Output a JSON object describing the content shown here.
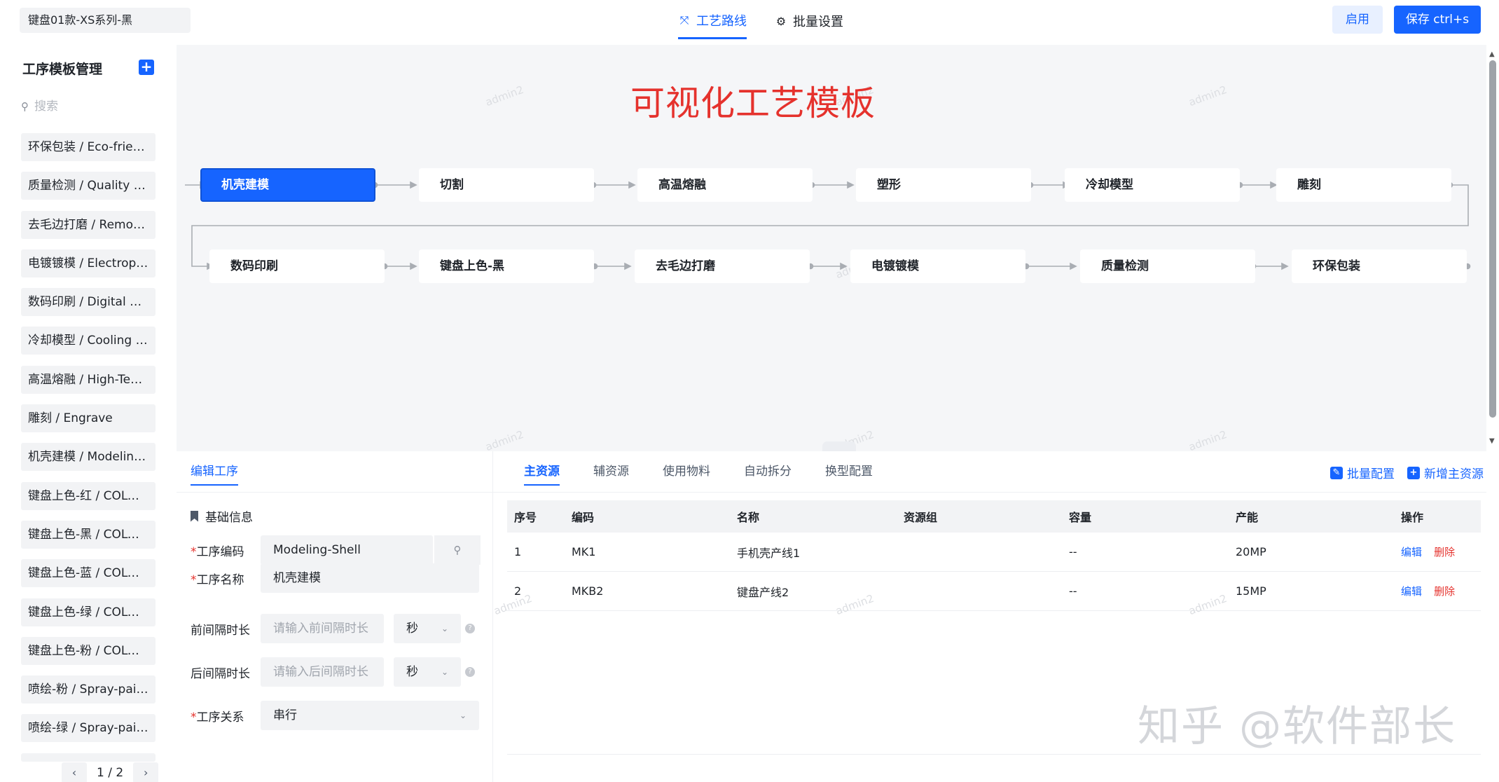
{
  "product": "键盘01款-XS系列-黑",
  "top_tabs": [
    {
      "label": "工艺路线",
      "icon": "route-icon",
      "active": true
    },
    {
      "label": "批量设置",
      "icon": "gear-icon",
      "active": false
    }
  ],
  "buttons": {
    "enable": "启用",
    "save": "保存 ctrl+s"
  },
  "sidebar": {
    "title": "工序模板管理",
    "search_placeholder": "搜索",
    "items": [
      "环保包装 / Eco-friendly Packaging",
      "质量检测 / Quality Inspection",
      "去毛边打磨 / Remove Burrs",
      "电镀镀模 / Electroplating",
      "数码印刷 / Digital Printing",
      "冷却模型 / Cooling Model",
      "高温熔融 / High-Temperature Melting",
      "雕刻 / Engrave",
      "机壳建模 / Modeling-Shell",
      "键盘上色-红 / COLOR-RED",
      "键盘上色-黑 / COLOR-BLACK",
      "键盘上色-蓝 / COLOR-BLUE",
      "键盘上色-绿 / COLOR-GREEN",
      "键盘上色-粉 / COLOR-PINK",
      "喷绘-粉 / Spray-paint-pink",
      "喷绘-绿 / Spray-paint-green"
    ],
    "pager": "1 / 2"
  },
  "canvas": {
    "title": "可视化工艺模板",
    "watermark": "admin2",
    "row1": [
      "机壳建模",
      "切割",
      "高温熔融",
      "塑形",
      "冷却模型",
      "雕刻"
    ],
    "row2": [
      "数码印刷",
      "键盘上色-黑",
      "去毛边打磨",
      "电镀镀模",
      "质量检测",
      "环保包装"
    ],
    "active_node": "机壳建模"
  },
  "edit": {
    "tab": "编辑工序",
    "section": "基础信息",
    "fields": {
      "code_label": "工序编码",
      "code_value": "Modeling-Shell",
      "name_label": "工序名称",
      "name_value": "机壳建模",
      "pre_label": "前间隔时长",
      "pre_placeholder": "请输入前间隔时长",
      "post_label": "后间隔时长",
      "post_placeholder": "请输入后间隔时长",
      "unit": "秒",
      "rel_label": "工序关系",
      "rel_value": "串行"
    }
  },
  "resources": {
    "tabs": [
      "主资源",
      "辅资源",
      "使用物料",
      "自动拆分",
      "换型配置"
    ],
    "actions": [
      "批量配置",
      "新增主资源"
    ],
    "columns": [
      "序号",
      "编码",
      "名称",
      "资源组",
      "容量",
      "产能",
      "操作"
    ],
    "rows": [
      {
        "no": "1",
        "code": "MK1",
        "name": "手机壳产线1",
        "group": "",
        "capacity": "--",
        "output": "20MP"
      },
      {
        "no": "2",
        "code": "MKB2",
        "name": "键盘产线2",
        "group": "",
        "capacity": "--",
        "output": "15MP"
      }
    ],
    "op_edit": "编辑",
    "op_delete": "删除"
  },
  "credit": "知乎 @软件部长",
  "colors": {
    "primary": "#1664ff",
    "danger": "#e5322d",
    "canvas_bg": "#f5f6f8"
  }
}
